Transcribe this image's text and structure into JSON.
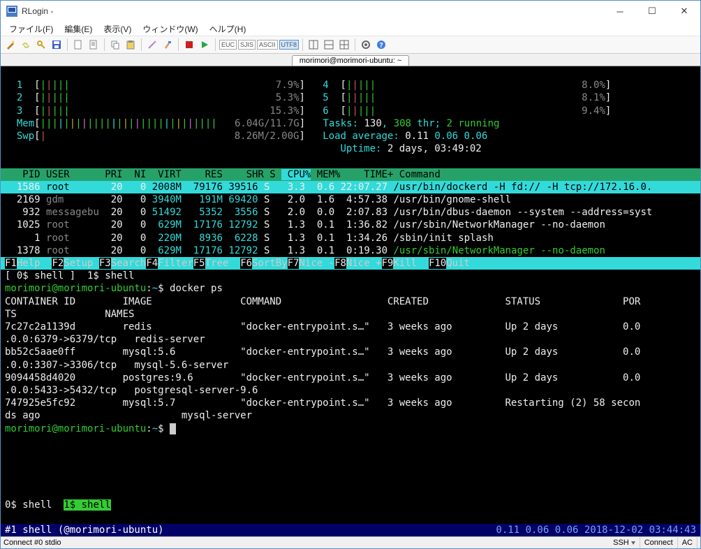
{
  "window": {
    "title": "RLogin -",
    "min_tip": "Minimize",
    "max_tip": "Maximize",
    "close_tip": "Close"
  },
  "menu": {
    "file": "ファイル(F)",
    "edit": "編集(E)",
    "view": "表示(V)",
    "window": "ウィンドウ(W)",
    "help": "ヘルプ(H)"
  },
  "encoding": {
    "euc": "EUC",
    "sjis": "SJIS",
    "ascii": "ASCII",
    "utf8": "UTF8"
  },
  "tab": {
    "label": "morimori@morimori-ubuntu: ~"
  },
  "htop": {
    "cpus": [
      {
        "id": "1",
        "pct": "7.9%"
      },
      {
        "id": "2",
        "pct": "5.3%"
      },
      {
        "id": "3",
        "pct": "15.3%"
      },
      {
        "id": "4",
        "pct": "8.0%"
      },
      {
        "id": "5",
        "pct": "8.1%"
      },
      {
        "id": "6",
        "pct": "9.4%"
      }
    ],
    "mem_label": "Mem",
    "mem_val": "6.04G/11.7G",
    "swp_label": "Swp",
    "swp_val": "8.26M/2.00G",
    "tasks_lbl": "Tasks:",
    "tasks_cnt": "130",
    "tasks_sep": ",",
    "thr_cnt": "308",
    "thr_lbl": "thr;",
    "running": "2 running",
    "load_lbl": "Load average:",
    "load1": "0.11",
    "load5": "0.06",
    "load15": "0.06",
    "uptime_lbl": "Uptime:",
    "uptime_val": "2 days, 03:49:02",
    "hdr": {
      "pid": "PID",
      "user": "USER",
      "pri": "PRI",
      "ni": "NI",
      "virt": "VIRT",
      "res": "RES",
      "shr": "SHR",
      "s": "S",
      "cpu": "CPU%",
      "mem": "MEM%",
      "time": "TIME+",
      "cmd": "Command"
    },
    "rows": [
      {
        "sel": true,
        "pid": "1586",
        "user": "root",
        "pri": "20",
        "ni": "0",
        "virt": "2008M",
        "res": "79176",
        "shr": "39516",
        "s": "S",
        "cpu": "3.3",
        "mem": "0.6",
        "time": "22:07.27",
        "cmd": "/usr/bin/dockerd -H fd:// -H tcp://172.16.0."
      },
      {
        "pid": "2169",
        "user": "gdm",
        "pri": "20",
        "ni": "0",
        "virt": "3940M",
        "res": "191M",
        "shr": "69420",
        "s": "S",
        "cpu": "2.0",
        "mem": "1.6",
        "time": "4:57.38",
        "cmd": "/usr/bin/gnome-shell"
      },
      {
        "pid": "932",
        "user": "messagebu",
        "pri": "20",
        "ni": "0",
        "virt": "51492",
        "res": "5352",
        "shr": "3556",
        "s": "S",
        "cpu": "2.0",
        "mem": "0.0",
        "time": "2:07.83",
        "cmd": "/usr/bin/dbus-daemon --system --address=syst"
      },
      {
        "pid": "1025",
        "user": "root",
        "pri": "20",
        "ni": "0",
        "virt": "629M",
        "res": "17176",
        "shr": "12792",
        "s": "S",
        "cpu": "1.3",
        "mem": "0.1",
        "time": "1:36.82",
        "cmd": "/usr/sbin/NetworkManager --no-daemon"
      },
      {
        "pid": "1",
        "user": "root",
        "pri": "20",
        "ni": "0",
        "virt": "220M",
        "res": "8936",
        "shr": "6228",
        "s": "S",
        "cpu": "1.3",
        "mem": "0.1",
        "time": "1:34.26",
        "cmd": "/sbin/init splash"
      },
      {
        "pid": "1378",
        "user": "root",
        "pri": "20",
        "ni": "0",
        "virt": "629M",
        "res": "17176",
        "shr": "12792",
        "s": "S",
        "cpu": "1.3",
        "mem": "0.1",
        "time": "0:19.30",
        "cmd": "/usr/sbin/NetworkManager --no-daemon",
        "cmdthr": true
      }
    ],
    "fkeys": [
      {
        "k": "F1",
        "l": "Help  "
      },
      {
        "k": "F2",
        "l": "Setup "
      },
      {
        "k": "F3",
        "l": "Search"
      },
      {
        "k": "F4",
        "l": "Filter"
      },
      {
        "k": "F5",
        "l": "Tree  "
      },
      {
        "k": "F6",
        "l": "SortBy"
      },
      {
        "k": "F7",
        "l": "Nice -"
      },
      {
        "k": "F8",
        "l": "Nice +"
      },
      {
        "k": "F9",
        "l": "Kill  "
      },
      {
        "k": "F10",
        "l": "Quit  "
      }
    ]
  },
  "tmux_top": "[ 0$ shell ]  1$ shell",
  "prompt1": {
    "user": "morimori@morimori-ubuntu",
    "sep": ":",
    "path": "~",
    "dollar": "$ ",
    "cmd": "docker ps"
  },
  "docker": {
    "hdr": "CONTAINER ID        IMAGE               COMMAND                  CREATED             STATUS              PORTS               NAMES",
    "rows": [
      "7c27c2a1139d        redis               \"docker-entrypoint.s…\"   3 weeks ago         Up 2 days           0.0.0.0:6379->6379/tcp   redis-server",
      "bb52c5aae0ff        mysql:5.6           \"docker-entrypoint.s…\"   3 weeks ago         Up 2 days           0.0.0.0:3307->3306/tcp   mysql-5.6-server",
      "9094458d4020        postgres:9.6        \"docker-entrypoint.s…\"   3 weeks ago         Up 2 days           0.0.0.0:5433->5432/tcp   postgresql-server-9.6",
      "747925e5fc92        mysql:5.7           \"docker-entrypoint.s…\"   3 weeks ago         Restarting (2) 58 seconds ago                        mysql-server"
    ]
  },
  "prompt2": {
    "user": "morimori@morimori-ubuntu",
    "sep": ":",
    "path": "~",
    "dollar": "$ "
  },
  "tmux_bottom": {
    "left0": "0$ shell  ",
    "left1": "1$ shell"
  },
  "bottom": {
    "left": "#1 shell (@morimori-ubuntu)",
    "right": "0.11 0.06 0.06 2018-12-02 03:44:43"
  },
  "status": {
    "left": "Connect #0 stdio",
    "ssh": "SSH",
    "connect": "Connect",
    "ac": "AC"
  }
}
